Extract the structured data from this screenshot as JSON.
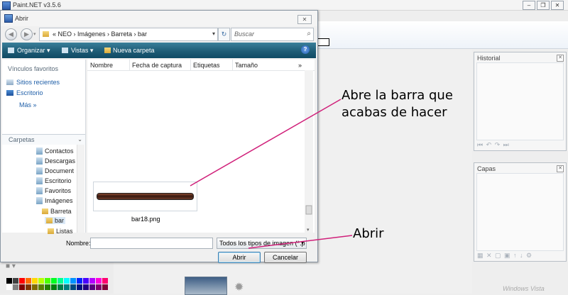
{
  "app": {
    "title": "Paint.NET v3.5.6"
  },
  "dialog": {
    "title": "Abrir",
    "path": "« NEO › Imágenes › Barreta › bar",
    "search_placeholder": "Buscar",
    "commands": {
      "organize": "Organizar ▾",
      "views": "Vistas ▾",
      "new_folder": "Nueva carpeta",
      "help": "?"
    },
    "favorites_heading": "Vínculos favoritos",
    "favorites": [
      "Sitios recientes",
      "Escritorio"
    ],
    "more": "Más »",
    "folders_heading": "Carpetas",
    "folders": [
      "Contactos",
      "Descargas",
      "Document",
      "Escritorio",
      "Favoritos",
      "Imágenes",
      "Barreta",
      "bar",
      "Listas"
    ],
    "columns": [
      "Nombre",
      "Fecha de captura",
      "Etiquetas",
      "Tamaño",
      "»"
    ],
    "file_name": "bar18.png",
    "name_label": "Nombre:",
    "name_value": "",
    "type_filter": "Todos los tipos de imagen (*.p",
    "open_button": "Abrir",
    "cancel_button": "Cancelar"
  },
  "panels": {
    "history_title": "Historial",
    "layers_title": "Capas"
  },
  "annotations": {
    "note1_line1": "Abre la barra que",
    "note1_line2": "acabas de hacer",
    "note2": "Abrir",
    "arrow_color": "#d0207a"
  },
  "branding": {
    "windows_text": "Windows Vista"
  },
  "palette": [
    "#000000",
    "#404040",
    "#ff0000",
    "#ff6a00",
    "#ffd800",
    "#b6ff00",
    "#4cff00",
    "#00ff21",
    "#00ff90",
    "#00ffff",
    "#0094ff",
    "#0026ff",
    "#4800ff",
    "#b200ff",
    "#ff00dc",
    "#ff006e",
    "#ffffff",
    "#808080",
    "#7f0000",
    "#7f3300",
    "#7f6a00",
    "#5b7f00",
    "#267f00",
    "#007f0e",
    "#007f46",
    "#007f7f",
    "#004a7f",
    "#00137f",
    "#21007f",
    "#57007f",
    "#7f006e",
    "#7f0037"
  ]
}
